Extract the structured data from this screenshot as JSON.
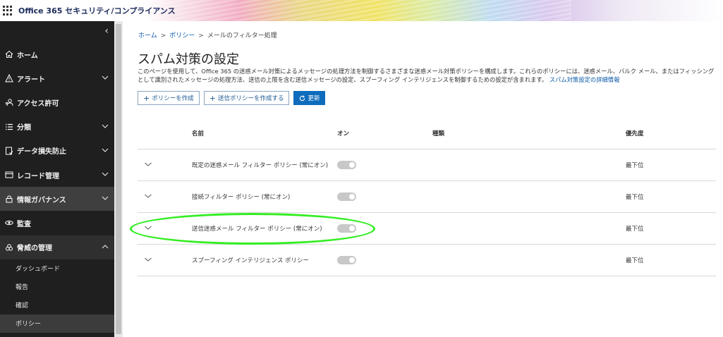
{
  "app": {
    "title": "Office 365 セキュリティ/コンプライアンス"
  },
  "sidebar": {
    "collapse_glyph": "‹",
    "items": [
      {
        "label": "ホーム",
        "icon": "home-icon",
        "has_chevron": false
      },
      {
        "label": "アラート",
        "icon": "warning-icon",
        "has_chevron": true
      },
      {
        "label": "アクセス許可",
        "icon": "permissions-icon",
        "has_chevron": false
      },
      {
        "label": "分類",
        "icon": "list-icon",
        "has_chevron": true
      },
      {
        "label": "データ損失防止",
        "icon": "dlp-icon",
        "has_chevron": true
      },
      {
        "label": "レコード管理",
        "icon": "records-icon",
        "has_chevron": true
      },
      {
        "label": "情報ガバナンス",
        "icon": "lock-icon",
        "has_chevron": true
      },
      {
        "label": "監査",
        "icon": "eye-icon",
        "has_chevron": false
      },
      {
        "label": "脅威の管理",
        "icon": "biohazard-icon",
        "has_chevron": true
      }
    ],
    "sub_items": [
      {
        "label": "ダッシュボード"
      },
      {
        "label": "報告"
      },
      {
        "label": "確認"
      },
      {
        "label": "ポリシー"
      }
    ]
  },
  "breadcrumb": {
    "home": "ホーム",
    "policy": "ポリシー",
    "current": "メールのフィルター処理",
    "sep": ">"
  },
  "page": {
    "title": "スパム対策の設定",
    "description": "このページを使用して、Office 365 の迷惑メール対策によるメッセージの処理方法を制御するさまざまな迷惑メール対策ポリシーを構成します。これらのポリシーには、迷惑メール、バルク メール、またはフィッシングとして識別されたメッセージの処理方法、送信の上限を含む送信メッセージの設定、スプーフィング インテリジェンスを制御するための設定が含まれます。",
    "link": "スパム対策設定の詳細情報"
  },
  "toolbar": {
    "create_policy": "ポリシーを作成",
    "create_outbound": "送信ポリシーを作成する",
    "refresh": "更新"
  },
  "table": {
    "headers": {
      "name": "名前",
      "on": "オン",
      "type": "種類",
      "priority": "優先度"
    },
    "rows": [
      {
        "name": "既定の迷惑メール フィルター ポリシー (常にオン)",
        "priority": "最下位"
      },
      {
        "name": "接続フィルター ポリシー (常にオン)",
        "priority": "最下位"
      },
      {
        "name": "送信迷惑メール フィルター ポリシー (常にオン)",
        "priority": "最下位"
      },
      {
        "name": "スプーフィング インテリジェンス ポリシー",
        "priority": "最下位"
      }
    ]
  },
  "colors": {
    "accent": "#0f6cbd",
    "sidebar_bg": "#1f1f1f",
    "annotation": "#33ee22"
  }
}
